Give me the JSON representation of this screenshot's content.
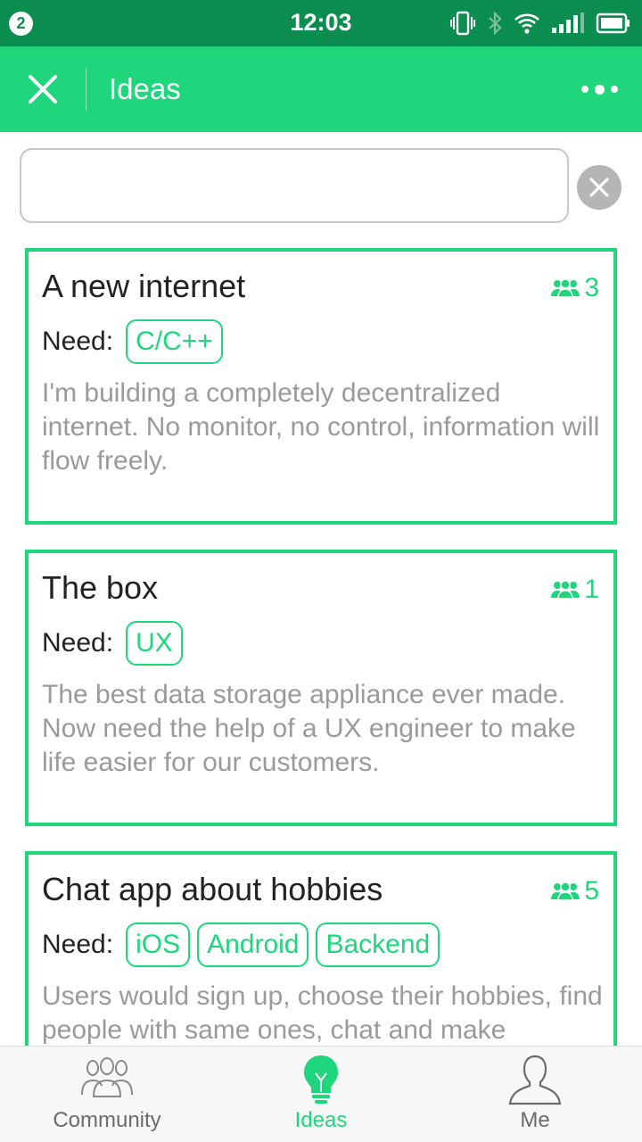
{
  "status_bar": {
    "notification_count": "2",
    "time": "12:03",
    "icons": [
      "vibrate-icon",
      "bluetooth-icon",
      "wifi-icon",
      "signal-icon",
      "battery-icon"
    ]
  },
  "app_bar": {
    "title": "Ideas",
    "close_icon": "close-icon",
    "more_icon": "more-icon"
  },
  "search": {
    "value": "",
    "placeholder": ""
  },
  "ideas": [
    {
      "title": "A new internet",
      "members": "3",
      "need_label": "Need:",
      "tags": [
        "C/C++"
      ],
      "description": "I'm building a completely decentralized internet. No monitor, no control, information will flow freely."
    },
    {
      "title": "The box",
      "members": "1",
      "need_label": "Need:",
      "tags": [
        "UX"
      ],
      "description": "The best data storage appliance ever made. Now need the help of a UX engineer to make life easier for our customers."
    },
    {
      "title": "Chat app about hobbies",
      "members": "5",
      "need_label": "Need:",
      "tags": [
        "iOS",
        "Android",
        "Backend"
      ],
      "description": "Users would sign up, choose their hobbies, find people with same ones, chat and make"
    }
  ],
  "tabs": [
    {
      "label": "Community",
      "icon": "community-icon",
      "active": false
    },
    {
      "label": "Ideas",
      "icon": "lightbulb-icon",
      "active": true
    },
    {
      "label": "Me",
      "icon": "person-icon",
      "active": false
    }
  ],
  "colors": {
    "status_bar": "#0a8d4e",
    "accent": "#1fd67d",
    "muted_text": "#9a9a9a"
  }
}
